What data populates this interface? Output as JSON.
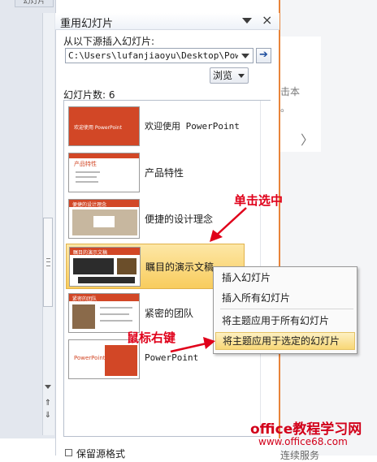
{
  "left": {
    "top_tab": "幻灯片",
    "prev_icon": "⇑",
    "next_icon": "⇓"
  },
  "panel": {
    "title": "重用幻灯片",
    "source_label": "从以下源插入幻灯片:",
    "source_value": "C:\\Users\\lufanjiaoyu\\Desktop\\Powe",
    "go_icon": "➔",
    "browse_label": "浏览",
    "count_label": "幻灯片数: 6",
    "close_glyph": "×"
  },
  "slides": [
    {
      "label": "欢迎使用 PowerPoint",
      "thumb_title": "欢迎使用 PowerPoint"
    },
    {
      "label": "产品特性",
      "thumb_title": "产品特性"
    },
    {
      "label": "便捷的设计理念",
      "thumb_title": "便捷的设计理念"
    },
    {
      "label": "瞩目的演示文稿",
      "thumb_title": "瞩目的演示文稿"
    },
    {
      "label": "紧密的团队",
      "thumb_title": "紧密的团队"
    },
    {
      "label": "PowerPoint",
      "thumb_title": "PowerPoint"
    }
  ],
  "keep_format_label": "保留源格式",
  "context_menu": {
    "items": [
      "插入幻灯片",
      "插入所有幻灯片",
      "将主题应用于所有幻灯片",
      "将主题应用于选定的幻灯片"
    ]
  },
  "right": {
    "text_1": "击本",
    "text_2": "。",
    "chevron": "〉",
    "bottom_text": "连续服务"
  },
  "annotations": {
    "click_select": "单击选中",
    "right_click": "鼠标右键"
  },
  "watermark": {
    "line1": "office教程学习网",
    "line2": "www.office68.com"
  },
  "colors": {
    "accent": "#d24726",
    "selected_bg": "#f8cc5d",
    "annotation_red": "#e0001a",
    "menu_highlight": "#f8d776"
  }
}
